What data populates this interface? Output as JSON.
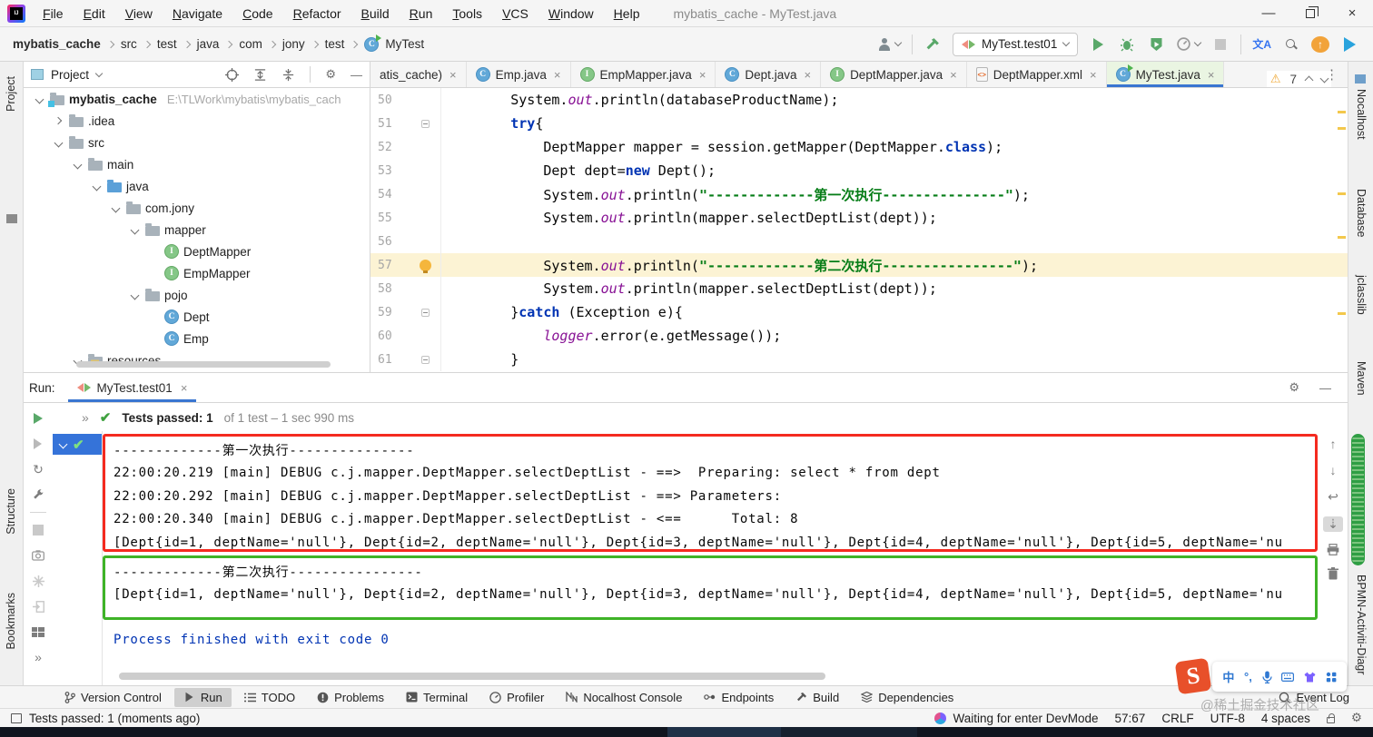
{
  "window": {
    "menu": [
      "File",
      "Edit",
      "View",
      "Navigate",
      "Code",
      "Refactor",
      "Build",
      "Run",
      "Tools",
      "VCS",
      "Window",
      "Help"
    ],
    "title": "mybatis_cache - MyTest.java"
  },
  "navbar": {
    "breadcrumb": [
      "mybatis_cache",
      "src",
      "test",
      "java",
      "com",
      "jony",
      "test",
      "MyTest"
    ],
    "run_config": "MyTest.test01"
  },
  "tabs": [
    {
      "label": "atis_cache)",
      "icon": "none",
      "active": false
    },
    {
      "label": "Emp.java",
      "icon": "class",
      "active": false
    },
    {
      "label": "EmpMapper.java",
      "icon": "iface",
      "active": false
    },
    {
      "label": "Dept.java",
      "icon": "class",
      "active": false
    },
    {
      "label": "DeptMapper.java",
      "icon": "iface",
      "active": false
    },
    {
      "label": "DeptMapper.xml",
      "icon": "xml",
      "active": false
    },
    {
      "label": "MyTest.java",
      "icon": "test",
      "active": true
    }
  ],
  "project": {
    "title": "Project",
    "tree": [
      {
        "label": "mybatis_cache",
        "icon": "root",
        "level": 0,
        "chev": "down",
        "bold": true,
        "suffix": "E:\\TLWork\\mybatis\\mybatis_cach"
      },
      {
        "label": ".idea",
        "icon": "folder",
        "level": 1,
        "chev": "right"
      },
      {
        "label": "src",
        "icon": "folder",
        "level": 1,
        "chev": "down"
      },
      {
        "label": "main",
        "icon": "folder",
        "level": 2,
        "chev": "down"
      },
      {
        "label": "java",
        "icon": "srcfolder",
        "level": 3,
        "chev": "down"
      },
      {
        "label": "com.jony",
        "icon": "pkg",
        "level": 4,
        "chev": "down"
      },
      {
        "label": "mapper",
        "icon": "pkg",
        "level": 5,
        "chev": "down"
      },
      {
        "label": "DeptMapper",
        "icon": "iface",
        "level": 6,
        "chev": "none"
      },
      {
        "label": "EmpMapper",
        "icon": "iface",
        "level": 6,
        "chev": "none"
      },
      {
        "label": "pojo",
        "icon": "pkg",
        "level": 5,
        "chev": "down"
      },
      {
        "label": "Dept",
        "icon": "class",
        "level": 6,
        "chev": "none"
      },
      {
        "label": "Emp",
        "icon": "class",
        "level": 6,
        "chev": "none"
      },
      {
        "label": "resources",
        "icon": "resfolder",
        "level": 2,
        "chev": "down"
      }
    ]
  },
  "editor": {
    "warning_count": "7",
    "lines": [
      {
        "n": "50",
        "ind": 8,
        "hl": false,
        "bulb": false,
        "fold": false,
        "segs": [
          [
            "System.",
            "pl"
          ],
          [
            "out",
            "fd"
          ],
          [
            ".println(databaseProductName);",
            "pl"
          ]
        ]
      },
      {
        "n": "51",
        "ind": 8,
        "hl": false,
        "bulb": false,
        "fold": true,
        "segs": [
          [
            "try",
            "kw"
          ],
          [
            "{",
            "pl"
          ]
        ]
      },
      {
        "n": "52",
        "ind": 12,
        "hl": false,
        "bulb": false,
        "fold": false,
        "segs": [
          [
            "DeptMapper mapper = session.getMapper(DeptMapper.",
            "pl"
          ],
          [
            "class",
            "kw"
          ],
          [
            ");",
            "pl"
          ]
        ]
      },
      {
        "n": "53",
        "ind": 12,
        "hl": false,
        "bulb": false,
        "fold": false,
        "segs": [
          [
            "Dept dept=",
            "pl"
          ],
          [
            "new",
            "kw"
          ],
          [
            " Dept();",
            "pl"
          ]
        ]
      },
      {
        "n": "54",
        "ind": 12,
        "hl": false,
        "bulb": false,
        "fold": false,
        "segs": [
          [
            "System.",
            "pl"
          ],
          [
            "out",
            "fd"
          ],
          [
            ".println(",
            "pl"
          ],
          [
            "\"-------------第一次执行---------------\"",
            "st"
          ],
          [
            ");",
            "pl"
          ]
        ]
      },
      {
        "n": "55",
        "ind": 12,
        "hl": false,
        "bulb": false,
        "fold": false,
        "segs": [
          [
            "System.",
            "pl"
          ],
          [
            "out",
            "fd"
          ],
          [
            ".println(mapper.selectDeptList(dept));",
            "pl"
          ]
        ]
      },
      {
        "n": "56",
        "ind": 0,
        "hl": false,
        "bulb": false,
        "fold": false,
        "segs": []
      },
      {
        "n": "57",
        "ind": 12,
        "hl": true,
        "bulb": true,
        "fold": false,
        "segs": [
          [
            "System.",
            "pl"
          ],
          [
            "out",
            "fd"
          ],
          [
            ".println(",
            "pl"
          ],
          [
            "\"-------------第二次执行----------------\"",
            "st"
          ],
          [
            ");",
            "pl"
          ]
        ]
      },
      {
        "n": "58",
        "ind": 12,
        "hl": false,
        "bulb": false,
        "fold": false,
        "segs": [
          [
            "System.",
            "pl"
          ],
          [
            "out",
            "fd"
          ],
          [
            ".println(mapper.selectDeptList(dept));",
            "pl"
          ]
        ]
      },
      {
        "n": "59",
        "ind": 8,
        "hl": false,
        "bulb": false,
        "fold": true,
        "segs": [
          [
            "}",
            "pl"
          ],
          [
            "catch",
            "kw"
          ],
          [
            " (Exception e){",
            "pl"
          ]
        ]
      },
      {
        "n": "60",
        "ind": 12,
        "hl": false,
        "bulb": false,
        "fold": false,
        "segs": [
          [
            "logger",
            "fd"
          ],
          [
            ".error(e.getMessage());",
            "pl"
          ]
        ]
      },
      {
        "n": "61",
        "ind": 8,
        "hl": false,
        "bulb": false,
        "fold": true,
        "segs": [
          [
            "}",
            "pl"
          ]
        ]
      }
    ]
  },
  "run_panel": {
    "label": "Run:",
    "tab": "MyTest.test01",
    "summary_bold": "Tests passed: 1",
    "summary_rest": "of 1 test – 1 sec 990 ms",
    "console": {
      "red_lines": [
        "-------------第一次执行---------------",
        "22:00:20.219 [main] DEBUG c.j.mapper.DeptMapper.selectDeptList - ==>  Preparing: select * from dept",
        "22:00:20.292 [main] DEBUG c.j.mapper.DeptMapper.selectDeptList - ==> Parameters: ",
        "22:00:20.340 [main] DEBUG c.j.mapper.DeptMapper.selectDeptList - <==      Total: 8",
        "[Dept{id=1, deptName='null'}, Dept{id=2, deptName='null'}, Dept{id=3, deptName='null'}, Dept{id=4, deptName='null'}, Dept{id=5, deptName='nu"
      ],
      "green_lines": [
        "-------------第二次执行----------------",
        "[Dept{id=1, deptName='null'}, Dept{id=2, deptName='null'}, Dept{id=3, deptName='null'}, Dept{id=4, deptName='null'}, Dept{id=5, deptName='nu"
      ],
      "exit_line": "Process finished with exit code 0"
    }
  },
  "tool_bar": {
    "items": [
      {
        "label": "Version Control",
        "icon": "branch",
        "active": false
      },
      {
        "label": "Run",
        "icon": "play",
        "active": true
      },
      {
        "label": "TODO",
        "icon": "todo",
        "active": false
      },
      {
        "label": "Problems",
        "icon": "problems",
        "active": false
      },
      {
        "label": "Terminal",
        "icon": "terminal",
        "active": false
      },
      {
        "label": "Profiler",
        "icon": "profiler",
        "active": false
      },
      {
        "label": "Nocalhost Console",
        "icon": "nocalhost",
        "active": false
      },
      {
        "label": "Endpoints",
        "icon": "endpoints",
        "active": false
      },
      {
        "label": "Build",
        "icon": "hammer",
        "active": false
      },
      {
        "label": "Dependencies",
        "icon": "deps",
        "active": false
      }
    ],
    "event_log": "Event Log"
  },
  "status_bar": {
    "message": "Tests passed: 1 (moments ago)",
    "devmode": "Waiting for enter DevMode",
    "caret": "57:67",
    "line_ending": "CRLF",
    "encoding": "UTF-8",
    "indent": "4 spaces"
  },
  "stripes": {
    "left_top": "Project",
    "left_lower": [
      "Structure",
      "Bookmarks"
    ],
    "right": [
      "Nocalhost",
      "Database",
      "jclasslib",
      "Maven"
    ],
    "right_bottom": "BPMN-Activiti-Diagr"
  },
  "ime": {
    "mode": "中"
  },
  "watermark": "@稀土掘金技术社区",
  "colors": {
    "accent": "#3a76d1",
    "run_green": "#59a869",
    "red_box": "#f42a1f",
    "green_box": "#3eb327",
    "warning": "#f0a732",
    "keyword": "#0033b3",
    "string": "#067d17",
    "field": "#871094",
    "exit_blue": "#0033b3"
  }
}
